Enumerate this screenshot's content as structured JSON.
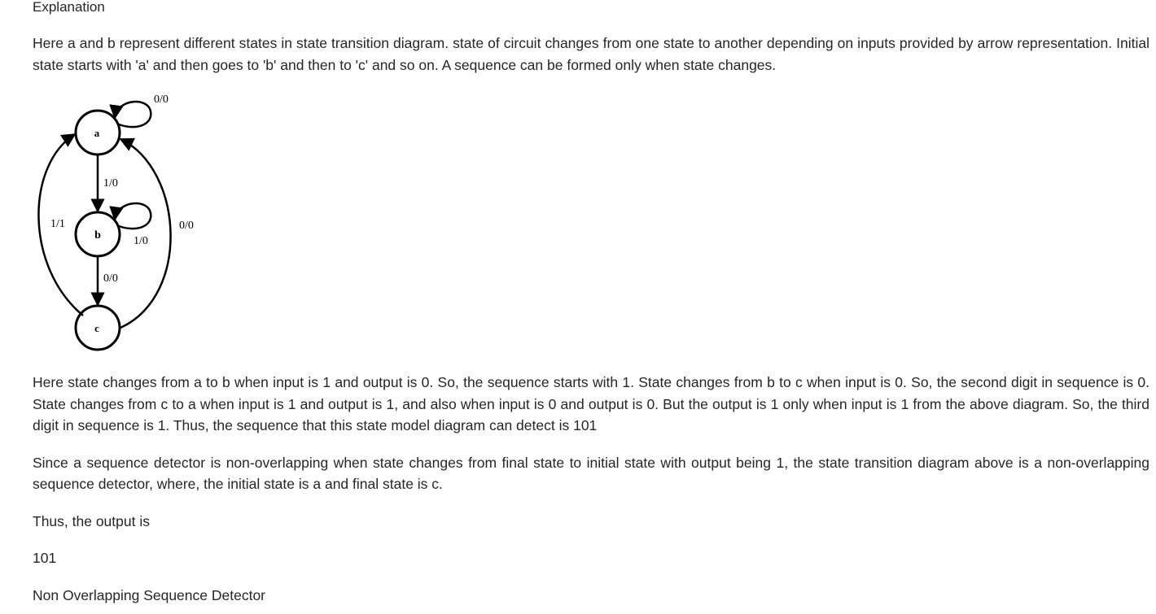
{
  "heading": "Explanation",
  "paragraphs": {
    "p1": "Here a and b represent different states in state transition diagram. state of circuit changes from one state to another depending on inputs provided by arrow representation. Initial state starts with 'a' and then goes to 'b' and then to 'c' and so on. A sequence can be formed only when state changes.",
    "p2": "Here state changes from a to b when input is 1 and output is 0. So, the sequence starts with 1. State changes from b to c when input is 0. So, the second digit in sequence is 0. State changes from c to a when input is 1 and output is 1, and also when input is 0 and output is 0. But the output is 1 only when input is 1 from the above diagram. So, the third digit in sequence is 1. Thus, the sequence that this state model diagram can detect is 101",
    "p3": "Since a sequence detector is non-overlapping when state changes from final state to initial state with output being 1, the state transition diagram above is a non-overlapping sequence detector, where, the initial state is a and final state is c.",
    "p4": "Thus, the output is",
    "p5": "101",
    "p6": "Non Overlapping Sequence Detector"
  },
  "diagram": {
    "states": {
      "a": "a",
      "b": "b",
      "c": "c"
    },
    "labels": {
      "a_self": "0/0",
      "a_to_b": "1/0",
      "b_self": "1/0",
      "b_to_c": "0/0",
      "c_to_a_left": "1/1",
      "c_to_a_right": "0/0"
    }
  }
}
